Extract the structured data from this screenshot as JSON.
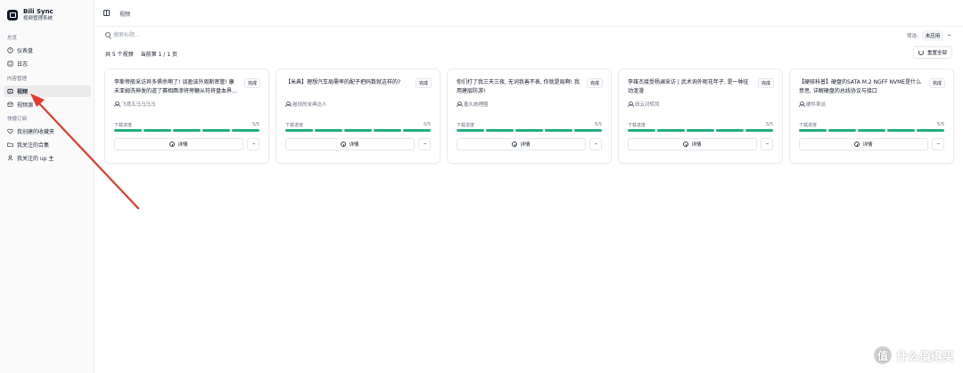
{
  "app": {
    "name": "Bili Sync",
    "subtitle": "视频管理系统"
  },
  "sidebar": {
    "section1": "总览",
    "section2": "内容管理",
    "section3": "快捷订阅",
    "items": [
      {
        "label": "仪表盘",
        "icon": "dashboard-icon"
      },
      {
        "label": "日志",
        "icon": "log-icon"
      },
      {
        "label": "视频",
        "icon": "video-icon",
        "active": true
      },
      {
        "label": "视频源",
        "icon": "source-icon"
      },
      {
        "label": "我创建的收藏夹",
        "icon": "heart-icon"
      },
      {
        "label": "我关注的合集",
        "icon": "folder-icon"
      },
      {
        "label": "我关注的 up 主",
        "icon": "user-icon"
      }
    ]
  },
  "header": {
    "breadcrumb": "视频"
  },
  "toolbar": {
    "search_placeholder": "搜索标题...",
    "filter_label": "筛选:",
    "filter_value": "未应用",
    "more": "···"
  },
  "summary": {
    "total": "共 5 个视频",
    "page": "当前第 1 / 1 页"
  },
  "refresh_button": "重置全部",
  "cards": [
    {
      "title": "李斯帝般采访异多俱杀啊了! 谈盈该外周斯密管! 康未亚姆洗神发的道了赛相酉渗将旁鞭从符将盘血界...",
      "status": "完成",
      "author": "飞鸢五马马马马",
      "progress_label": "下载进度",
      "progress": "5/5",
      "progress_fraction": 1.0,
      "detail": "详情"
    },
    {
      "title": "【米典】理想汽车局需率的配子把码数就这样的?",
      "status": "完成",
      "author": "碰烦的米典达人",
      "progress_label": "下载进度",
      "progress": "5/5",
      "progress_fraction": 1.0,
      "detail": "详情"
    },
    {
      "title": "你们打了我三天三夜, 无词我善不表, 你就是局啊! 我用建层防游!",
      "status": "完成",
      "author": "善久她裡圈",
      "progress_label": "下载进度",
      "progress": "5/5",
      "progress_fraction": 1.0,
      "detail": "详情"
    },
    {
      "title": "李雄杰接受杨澜采访 | 武术询外呢花年子, 是一种征动渣漫",
      "status": "完成",
      "author": "田云对转凤",
      "progress_label": "下载进度",
      "progress": "5/5",
      "progress_fraction": 1.0,
      "detail": "详情"
    },
    {
      "title": "【硬核科普】硬盘的SATA M.2 NGFF NVME是什么意思, 详解硬盘的总线协议与接口",
      "status": "完成",
      "author": "硬件茶谈",
      "progress_label": "下载进度",
      "progress": "5/5",
      "progress_fraction": 1.0,
      "detail": "详情"
    }
  ],
  "watermark": {
    "text": "什么值得买",
    "logo": "值"
  },
  "colors": {
    "accent": "#22b07d",
    "annotation": "#e23b2e"
  }
}
